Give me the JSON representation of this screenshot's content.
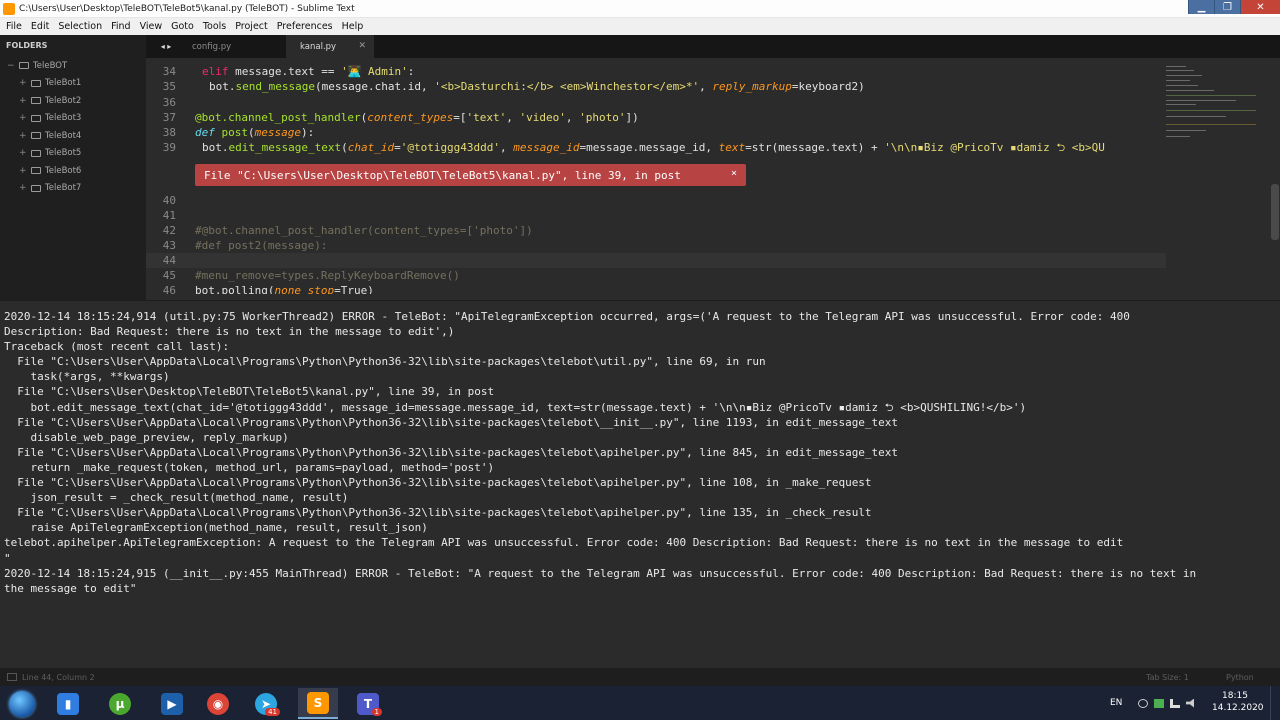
{
  "window": {
    "title": "C:\\Users\\User\\Desktop\\TeleBOT\\TeleBot5\\kanal.py (TeleBOT) - Sublime Text",
    "minimize": "▁",
    "maximize": "❐",
    "close": "✕"
  },
  "menu": [
    "File",
    "Edit",
    "Selection",
    "Find",
    "View",
    "Goto",
    "Tools",
    "Project",
    "Preferences",
    "Help"
  ],
  "sidebar": {
    "header": "FOLDERS",
    "root": "TeleBOT",
    "items": [
      "TeleBot1",
      "TeleBot2",
      "TeleBot3",
      "TeleBot4",
      "TeleBot5",
      "TeleBot6",
      "TeleBot7"
    ]
  },
  "tabs": {
    "nav": "◂ ▸",
    "items": [
      {
        "label": "config.py",
        "active": false
      },
      {
        "label": "kanal.py",
        "active": true
      }
    ],
    "close_glyph": "✕"
  },
  "editor": {
    "lines": {
      "l34": {
        "num": "34",
        "a": "elif",
        "b": " message.text == ",
        "c": "'👨‍💻 Admin'",
        "d": ":"
      },
      "l35": {
        "num": "35",
        "a": "bot.",
        "b": "send_message",
        "c": "(message.chat.id, ",
        "d": "'<b>Dasturchi:</b> <em>Winchestor</em>*'",
        "e": ", ",
        "f": "reply_markup",
        "g": "=keyboard2)"
      },
      "l36": {
        "num": "36"
      },
      "l37": {
        "num": "37",
        "a": "@bot.channel_post_handler",
        "b": "(",
        "c": "content_types",
        "d": "=[",
        "e": "'text'",
        "f": ", ",
        "g": "'video'",
        "h": ", ",
        "i": "'photo'",
        "j": "])"
      },
      "l38": {
        "num": "38",
        "a": "def",
        "b": " ",
        "c": "post",
        "d": "(",
        "e": "message",
        "f": "):"
      },
      "l39": {
        "num": "39",
        "a": "bot.",
        "b": "edit_message_text",
        "c": "(",
        "d": "chat_id",
        "e": "=",
        "f": "'@totiggg43ddd'",
        "g": ", ",
        "h": "message_id",
        "i": "=message.message_id, ",
        "j": "text",
        "k": "=str(message.text) + ",
        "l": "'\\n\\n▪Biz @PricoTv ▪damiz ⮌ <b>QU"
      },
      "l40": {
        "num": "40"
      },
      "l41": {
        "num": "41"
      },
      "l42": {
        "num": "42",
        "text": "#@bot.channel_post_handler(content_types=['photo'])"
      },
      "l43": {
        "num": "43",
        "text": "#def post2(message):"
      },
      "l44": {
        "num": "44"
      },
      "l45": {
        "num": "45",
        "text": "#menu_remove=types.ReplyKeyboardRemove()"
      },
      "l46": {
        "num": "46",
        "a": "bot.polling(",
        "b": "none_stop",
        "c": "=True)"
      }
    },
    "error_phantom": {
      "text": "File \"C:\\Users\\User\\Desktop\\TeleBOT\\TeleBot5\\kanal.py\", line 39, in post",
      "close": "×"
    }
  },
  "console": {
    "lines": [
      "2020-12-14 18:15:24,914 (util.py:75 WorkerThread2) ERROR - TeleBot: \"ApiTelegramException occurred, args=('A request to the Telegram API was unsuccessful. Error code: 400",
      "Description: Bad Request: there is no text in the message to edit',)",
      "Traceback (most recent call last):",
      "  File \"C:\\Users\\User\\AppData\\Local\\Programs\\Python\\Python36-32\\lib\\site-packages\\telebot\\util.py\", line 69, in run",
      "    task(*args, **kwargs)",
      "  File \"C:\\Users\\User\\Desktop\\TeleBOT\\TeleBot5\\kanal.py\", line 39, in post",
      "    bot.edit_message_text(chat_id='@totiggg43ddd', message_id=message.message_id, text=str(message.text) + '\\n\\n▪Biz @PricoTv ▪damiz ⮌ <b>QUSHILING!</b>')",
      "  File \"C:\\Users\\User\\AppData\\Local\\Programs\\Python\\Python36-32\\lib\\site-packages\\telebot\\__init__.py\", line 1193, in edit_message_text",
      "    disable_web_page_preview, reply_markup)",
      "  File \"C:\\Users\\User\\AppData\\Local\\Programs\\Python\\Python36-32\\lib\\site-packages\\telebot\\apihelper.py\", line 845, in edit_message_text",
      "    return _make_request(token, method_url, params=payload, method='post')",
      "  File \"C:\\Users\\User\\AppData\\Local\\Programs\\Python\\Python36-32\\lib\\site-packages\\telebot\\apihelper.py\", line 108, in _make_request",
      "    json_result = _check_result(method_name, result)",
      "  File \"C:\\Users\\User\\AppData\\Local\\Programs\\Python\\Python36-32\\lib\\site-packages\\telebot\\apihelper.py\", line 135, in _check_result",
      "    raise ApiTelegramException(method_name, result, result_json)",
      "telebot.apihelper.ApiTelegramException: A request to the Telegram API was unsuccessful. Error code: 400 Description: Bad Request: there is no text in the message to edit",
      "\"",
      "2020-12-14 18:15:24,915 (__init__.py:455 MainThread) ERROR - TeleBot: \"A request to the Telegram API was unsuccessful. Error code: 400 Description: Bad Request: there is no text in",
      "the message to edit\""
    ]
  },
  "status": {
    "position": "Line 44, Column 2",
    "tab_size": "Tab Size: 1",
    "syntax": "Python"
  },
  "taskbar": {
    "apps": [
      {
        "name": "explorer",
        "glyph": "▮",
        "color": "#2f7de1"
      },
      {
        "name": "utorrent",
        "glyph": "µ",
        "color": "#4aa82f"
      },
      {
        "name": "media-player",
        "glyph": "▶",
        "color": "#1d5fa8"
      },
      {
        "name": "chrome",
        "glyph": "◉",
        "color": "#db4437"
      },
      {
        "name": "telegram",
        "glyph": "➤",
        "color": "#2ca5e0",
        "badge": "41"
      },
      {
        "name": "sublime-text",
        "glyph": "S",
        "color": "#ff9800"
      },
      {
        "name": "teams",
        "glyph": "T",
        "color": "#5059c9",
        "badge": "1"
      }
    ],
    "language": "EN",
    "time": "18:15",
    "date": "14.12.2020"
  },
  "colors": {
    "editor_bg": "#2b2b2b",
    "error_bg": "#b84343",
    "taskbar_bg": "#1b2233",
    "accent_sublime": "#ff9800"
  }
}
